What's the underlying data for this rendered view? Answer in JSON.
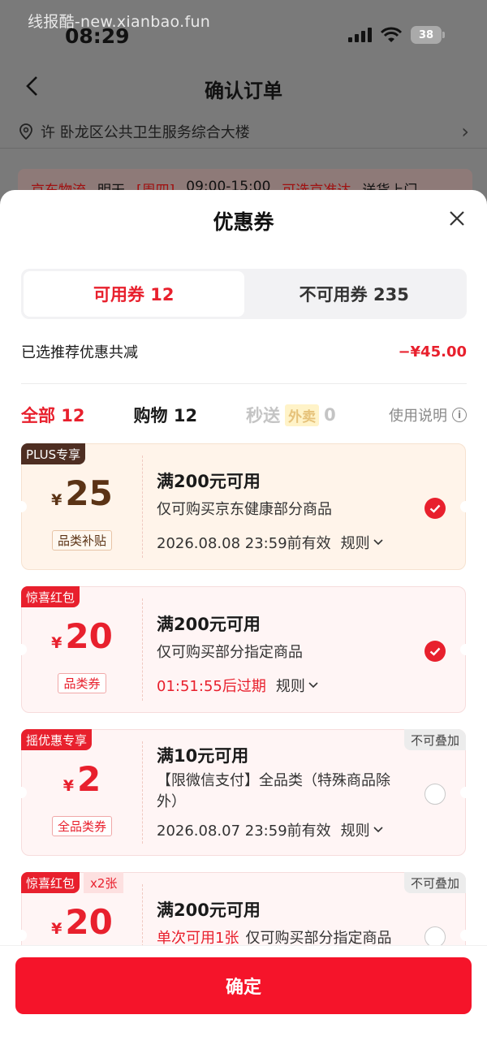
{
  "watermark": "线报酷-new.xianbao.fun",
  "status_bar": {
    "time": "08:29",
    "battery": "38"
  },
  "background_page": {
    "title": "确认订单",
    "address": "许  卧龙区公共卫生服务综合大楼",
    "delivery": {
      "carrier": "京东物流",
      "day": "明天",
      "weekday": "[周四]",
      "time_range": "09:00-15:00",
      "option": "可选京准达",
      "method": "送货上门"
    }
  },
  "sheet": {
    "title": "优惠券",
    "tabs": [
      {
        "label": "可用券 12",
        "active": true
      },
      {
        "label": "不可用券 235",
        "active": false
      }
    ],
    "summary": {
      "label": "已选推荐优惠共减",
      "value": "−¥45.00"
    },
    "filters": {
      "all": "全部 12",
      "shopping": "购物 12",
      "instant": "秒送",
      "instant_tag": "外卖",
      "instant_count": "0",
      "usage": "使用说明"
    },
    "coupons": [
      {
        "badge": "PLUS专享",
        "currency": "¥",
        "amount": "25",
        "category": "品类补贴",
        "title": "满200元可用",
        "desc": "仅可购买京东健康部分商品",
        "expiry": "2026.08.08 23:59前有效",
        "rule": "规则",
        "selected": true
      },
      {
        "badge": "惊喜红包",
        "currency": "¥",
        "amount": "20",
        "category": "品类券",
        "title": "满200元可用",
        "desc": "仅可购买部分指定商品",
        "expiry": "01:51:55后过期",
        "rule": "规则",
        "selected": true
      },
      {
        "badge": "摇优惠专享",
        "not_stackable": "不可叠加",
        "currency": "¥",
        "amount": "2",
        "category": "全品类券",
        "title": "满10元可用",
        "desc": "【限微信支付】全品类（特殊商品除外）",
        "expiry": "2026.08.07 23:59前有效",
        "rule": "规则",
        "selected": false
      },
      {
        "badge": "惊喜红包",
        "badge_extra": "x2张",
        "not_stackable": "不可叠加",
        "currency": "¥",
        "amount": "20",
        "title": "满200元可用",
        "desc_highlight": "单次可用1张",
        "desc": "仅可购买部分指定商品",
        "selected": false
      }
    ],
    "confirm": "确定"
  }
}
